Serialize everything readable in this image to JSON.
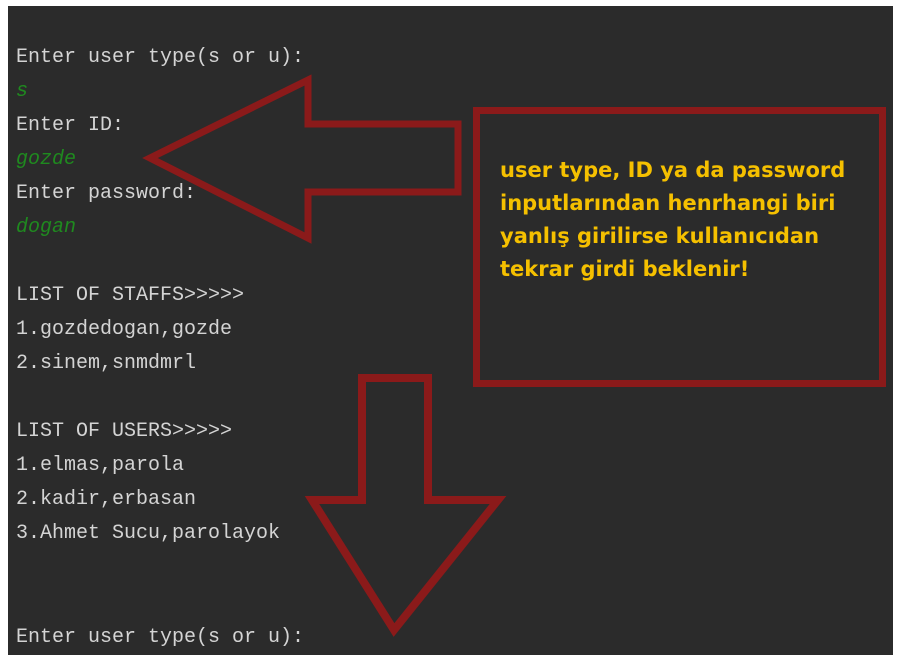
{
  "console": {
    "lines": [
      {
        "text": "Enter user type(s or u):",
        "kind": "output"
      },
      {
        "text": "s",
        "kind": "input"
      },
      {
        "text": "Enter ID:",
        "kind": "output"
      },
      {
        "text": "gozde",
        "kind": "input"
      },
      {
        "text": "Enter password:",
        "kind": "output"
      },
      {
        "text": "dogan",
        "kind": "input"
      },
      {
        "text": "",
        "kind": "blank"
      },
      {
        "text": "LIST OF STAFFS>>>>>",
        "kind": "output"
      },
      {
        "text": "1.gozdedogan,gozde",
        "kind": "output"
      },
      {
        "text": "2.sinem,snmdmrl",
        "kind": "output"
      },
      {
        "text": "",
        "kind": "blank"
      },
      {
        "text": "LIST OF USERS>>>>>",
        "kind": "output"
      },
      {
        "text": "1.elmas,parola",
        "kind": "output"
      },
      {
        "text": "2.kadir,erbasan",
        "kind": "output"
      },
      {
        "text": "3.Ahmet Sucu,parolayok",
        "kind": "output"
      },
      {
        "text": "",
        "kind": "blank"
      },
      {
        "text": "",
        "kind": "blank"
      },
      {
        "text": "Enter user type(s or u):",
        "kind": "output"
      }
    ]
  },
  "annotation": {
    "text_lines": [
      "user type, ID ya da password",
      "inputlarından henrhangi biri",
      "yanlış girilirse kullanıcıdan",
      "tekrar girdi beklenir!"
    ],
    "box_border_color": "#8b1a1a",
    "text_color": "#f5c000"
  },
  "colors": {
    "console_background": "#2b2b2b",
    "console_text": "#d4d4d4",
    "input_text": "#1f8a1f",
    "arrow_outline": "#8b1a1a"
  },
  "icons": [
    "left-arrow-icon",
    "down-arrow-icon"
  ]
}
